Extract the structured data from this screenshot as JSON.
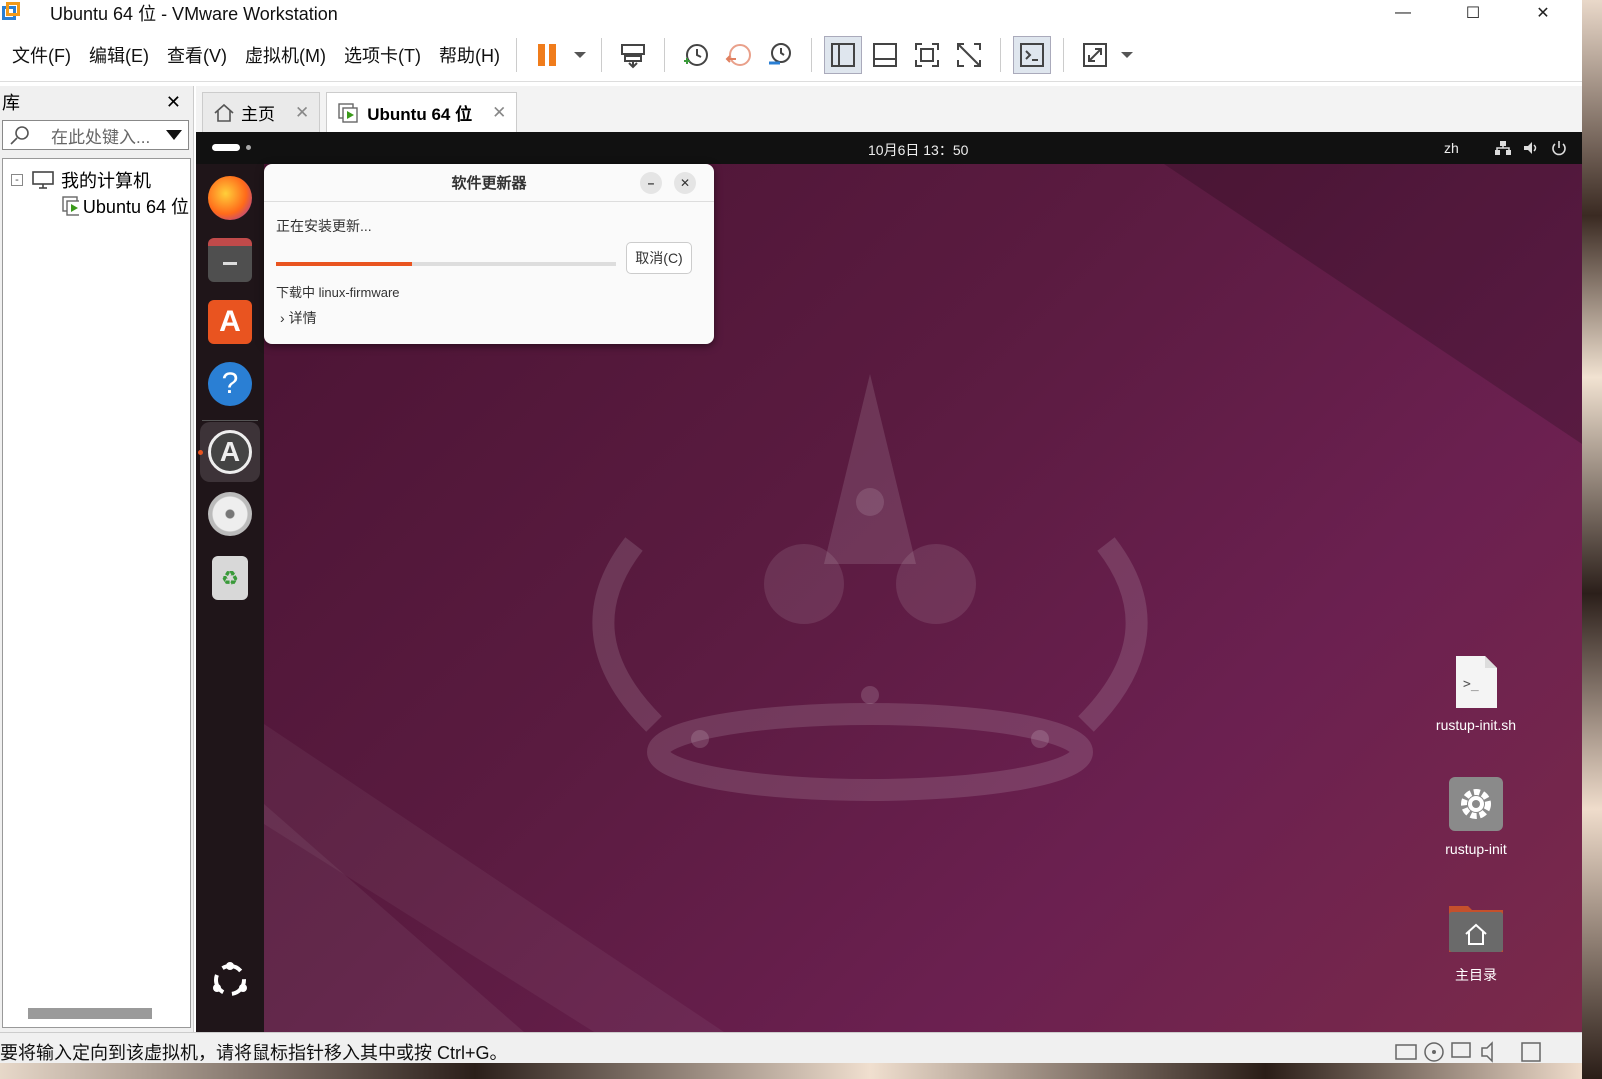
{
  "window": {
    "title": "Ubuntu 64 位 - VMware Workstation"
  },
  "menu": [
    "文件(F)",
    "编辑(E)",
    "查看(V)",
    "虚拟机(M)",
    "选项卡(T)",
    "帮助(H)"
  ],
  "library": {
    "title": "库",
    "search_placeholder": "在此处键入...",
    "tree_root": "我的计算机",
    "tree_child": "Ubuntu 64 位"
  },
  "tabs": [
    {
      "label": "主页"
    },
    {
      "label": "Ubuntu 64 位"
    }
  ],
  "ubuntu": {
    "clock": "10月6日  13：50",
    "lang": "zh"
  },
  "dialog": {
    "title": "软件更新器",
    "status": "正在安装更新...",
    "cancel": "取消(C)",
    "download": "下载中 linux-firmware",
    "details": "详情",
    "progress": 0.4
  },
  "desktop_icons": [
    {
      "label": "rustup-init.sh",
      "icon": "script-file-icon"
    },
    {
      "label": "rustup-init",
      "icon": "gear-executable-icon"
    },
    {
      "label": "主目录",
      "icon": "home-folder-icon"
    }
  ],
  "statusbar": {
    "text": "要将输入定向到该虚拟机，请将鼠标指针移入其中或按 Ctrl+G。"
  },
  "colors": {
    "accent": "#e95420",
    "pause": "#f07c1b",
    "dock": "#1f1519",
    "wallpaper": "#5e1c40"
  }
}
